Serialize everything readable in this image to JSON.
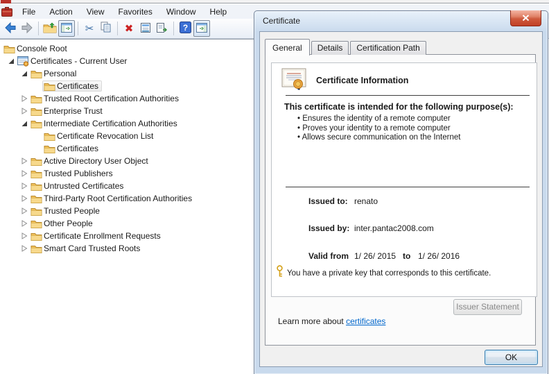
{
  "chrome": {
    "app_icon": "mmc-console-icon",
    "menu": [
      "File",
      "Action",
      "View",
      "Favorites",
      "Window",
      "Help"
    ],
    "toolbar": [
      {
        "icon": "back-icon"
      },
      {
        "icon": "forward-icon"
      },
      {
        "separator": true
      },
      {
        "icon": "up-one-level-icon"
      },
      {
        "icon": "show-console-tree-icon",
        "boxed": true
      },
      {
        "separator": true
      },
      {
        "icon": "cut-icon"
      },
      {
        "icon": "copy-icon"
      },
      {
        "separator": true
      },
      {
        "icon": "delete-icon"
      },
      {
        "icon": "properties-icon"
      },
      {
        "icon": "export-list-icon"
      },
      {
        "separator": true
      },
      {
        "icon": "help-icon"
      },
      {
        "icon": "show-action-pane-icon",
        "boxed": true
      }
    ]
  },
  "tree": {
    "items": [
      {
        "label": "Console Root",
        "level": 0,
        "state": "none",
        "icon": "folder",
        "selected": false
      },
      {
        "label": "Certificates - Current User",
        "level": 1,
        "state": "expanded",
        "icon": "certmgr",
        "selected": false
      },
      {
        "label": "Personal",
        "level": 2,
        "state": "expanded",
        "icon": "folder",
        "selected": false
      },
      {
        "label": "Certificates",
        "level": 3,
        "state": "none",
        "icon": "folder",
        "selected": true
      },
      {
        "label": "Trusted Root Certification Authorities",
        "level": 2,
        "state": "collapsed",
        "icon": "folder",
        "selected": false
      },
      {
        "label": "Enterprise Trust",
        "level": 2,
        "state": "collapsed",
        "icon": "folder",
        "selected": false
      },
      {
        "label": "Intermediate Certification Authorities",
        "level": 2,
        "state": "expanded",
        "icon": "folder",
        "selected": false
      },
      {
        "label": "Certificate Revocation List",
        "level": 3,
        "state": "none",
        "icon": "folder",
        "selected": false
      },
      {
        "label": "Certificates",
        "level": 3,
        "state": "none",
        "icon": "folder",
        "selected": false
      },
      {
        "label": "Active Directory User Object",
        "level": 2,
        "state": "collapsed",
        "icon": "folder",
        "selected": false
      },
      {
        "label": "Trusted Publishers",
        "level": 2,
        "state": "collapsed",
        "icon": "folder",
        "selected": false
      },
      {
        "label": "Untrusted Certificates",
        "level": 2,
        "state": "collapsed",
        "icon": "folder",
        "selected": false
      },
      {
        "label": "Third-Party Root Certification Authorities",
        "level": 2,
        "state": "collapsed",
        "icon": "folder",
        "selected": false
      },
      {
        "label": "Trusted People",
        "level": 2,
        "state": "collapsed",
        "icon": "folder",
        "selected": false
      },
      {
        "label": "Other People",
        "level": 2,
        "state": "collapsed",
        "icon": "folder",
        "selected": false
      },
      {
        "label": "Certificate Enrollment Requests",
        "level": 2,
        "state": "collapsed",
        "icon": "folder",
        "selected": false
      },
      {
        "label": "Smart Card Trusted Roots",
        "level": 2,
        "state": "collapsed",
        "icon": "folder",
        "selected": false
      }
    ]
  },
  "dialog": {
    "title": "Certificate",
    "close_icon": "close-icon",
    "tabs": [
      {
        "label": "General",
        "active": true
      },
      {
        "label": "Details",
        "active": false
      },
      {
        "label": "Certification Path",
        "active": false
      }
    ],
    "info_title": "Certificate Information",
    "purpose_heading": "This certificate is intended for the following purpose(s):",
    "purposes": [
      "Ensures the identity of a remote computer",
      "Proves your identity to a remote computer",
      "Allows secure communication on the Internet"
    ],
    "issued_to_label": "Issued to:",
    "issued_to": "renato",
    "issued_by_label": "Issued by:",
    "issued_by": "inter.pantac2008.com",
    "valid_from_label": "Valid from",
    "valid_from": "1/ 26/ 2015",
    "valid_to_label": "to",
    "valid_to": "1/ 26/ 2016",
    "private_key_note": "You have a private key that corresponds to this certificate.",
    "issuer_statement_label": "Issuer Statement",
    "learn_more_text": "Learn more about ",
    "learn_more_link": "certificates",
    "ok_label": "OK"
  },
  "colors": {
    "close_button_red": "#c14026",
    "link_blue": "#0066cc",
    "folder_gold": "#f0c05a",
    "dialog_glass": "#c9daed",
    "seal_gold": "#e8a33d"
  }
}
